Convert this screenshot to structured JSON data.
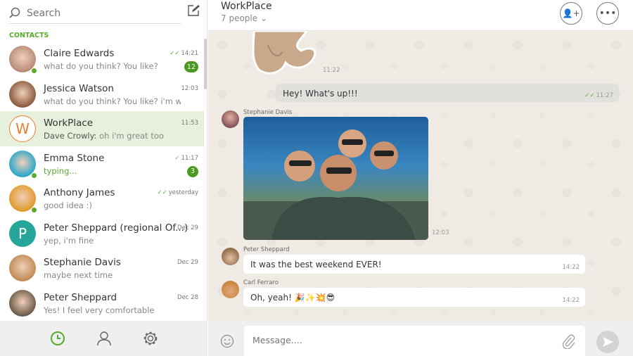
{
  "sidebar": {
    "search_placeholder": "Search",
    "section_label": "CONTACTS",
    "contacts": [
      {
        "name": "Claire Edwards",
        "preview": "what do you think? You like?",
        "time": "14:21",
        "ticks": "double",
        "badge": "12",
        "online": true,
        "avatar_color": "#b88a78"
      },
      {
        "name": "Jessica Watson",
        "preview": "what do you think? You like? i'm wo...",
        "time": "12:03",
        "avatar_color": "#8a5a3e"
      },
      {
        "name": "WorkPlace",
        "sender": "Dave Crowly:",
        "preview": " oh i'm great too",
        "time": "11:53",
        "letter": "W",
        "active": true,
        "avatar_color": "#f07b2d"
      },
      {
        "name": "Emma Stone",
        "preview": "typing...",
        "time": "11:17",
        "ticks": "single",
        "badge": "3",
        "online": true,
        "typing": true,
        "avatar_color": "#2aa7c9"
      },
      {
        "name": "Anthony James",
        "preview": "good idea :)",
        "time": "yesterday",
        "ticks": "double",
        "online": true,
        "avatar_color": "#e09a2b"
      },
      {
        "name": "Peter Sheppard (regional Of...)",
        "preview": "yep, i'm fine",
        "time": "Dec 29",
        "letter": "P",
        "avatar_color": "#26a69a"
      },
      {
        "name": "Stephanie Davis",
        "preview": "maybe next time",
        "time": "Dec 29",
        "avatar_color": "#c08a55"
      },
      {
        "name": "Peter Sheppard",
        "preview": "Yes! I feel very comfortable",
        "time": "Dec 28",
        "avatar_color": "#6b5a4a"
      }
    ],
    "nav_icons": [
      "clock-icon",
      "person-icon",
      "gear-icon"
    ]
  },
  "chat": {
    "title": "WorkPlace",
    "subtitle": "7 people",
    "messages": [
      {
        "type": "sticker",
        "time": "11:22"
      },
      {
        "type": "outgoing",
        "text": "Hey! What's up!!!",
        "time": "11:27"
      },
      {
        "type": "photo",
        "sender": "Stephanie Davis",
        "time": "12:03"
      },
      {
        "type": "incoming",
        "sender": "Peter Sheppard",
        "text": "It was the best weekend EVER!",
        "time": "14:22"
      },
      {
        "type": "incoming",
        "sender": "Carl Ferraro",
        "text": "Oh, yeah! 🎉✨💥😎",
        "time": "14:22"
      }
    ],
    "input_placeholder": "Message...."
  },
  "colors": {
    "accent": "#5aab2c",
    "active_row": "#e6f0dd",
    "chat_bg": "#efebe4"
  }
}
